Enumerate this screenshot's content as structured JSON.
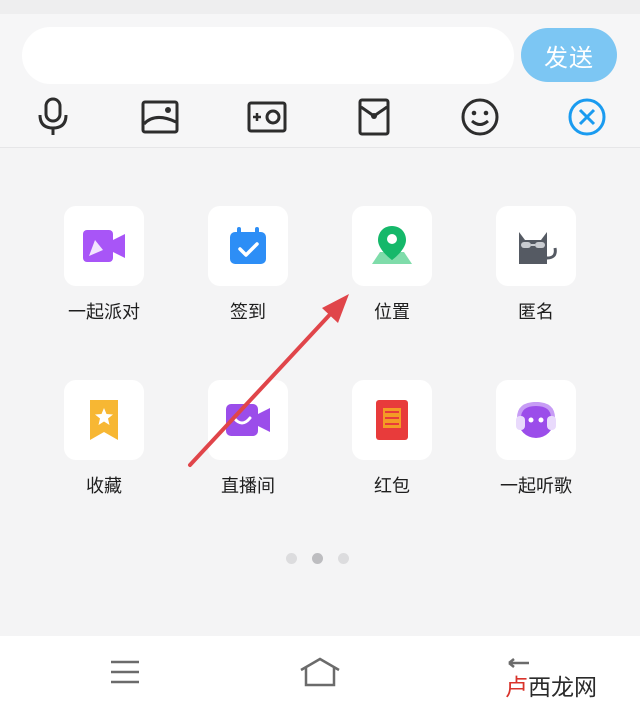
{
  "composer": {
    "input_value": "",
    "input_placeholder": "",
    "send_label": "发送"
  },
  "toolbar": {
    "tools": [
      {
        "icon": "microphone-icon"
      },
      {
        "icon": "image-icon"
      },
      {
        "icon": "camera-icon"
      },
      {
        "icon": "red-packet-icon"
      },
      {
        "icon": "emoji-icon"
      },
      {
        "icon": "close-circle-icon"
      }
    ],
    "accent_color": "#1a9bf0"
  },
  "grid": {
    "items": [
      {
        "label": "一起派对",
        "icon": "party-video-icon"
      },
      {
        "label": "签到",
        "icon": "calendar-checkin-icon"
      },
      {
        "label": "位置",
        "icon": "location-pin-icon"
      },
      {
        "label": "匿名",
        "icon": "anonymous-cat-icon"
      },
      {
        "label": "收藏",
        "icon": "favorites-star-icon"
      },
      {
        "label": "直播间",
        "icon": "live-room-icon"
      },
      {
        "label": "红包",
        "icon": "red-envelope-icon"
      },
      {
        "label": "一起听歌",
        "icon": "listen-together-icon"
      }
    ]
  },
  "pager": {
    "pages": 3,
    "active_index": 1
  },
  "navbar": {
    "icons": [
      "menu-icon",
      "home-icon",
      "back-icon"
    ]
  },
  "watermark": {
    "red_text": "卢",
    "dark_text": "西龙网"
  },
  "annotation": {
    "color": "#e0454a"
  }
}
